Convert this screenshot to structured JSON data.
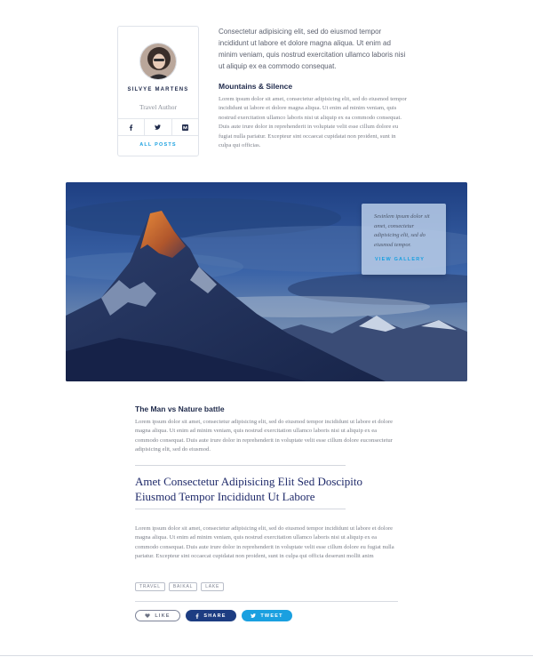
{
  "author": {
    "name": "SILVYE MARTENS",
    "role": "Travel Author",
    "all_posts_label": "ALL POSTS",
    "social": [
      "facebook-icon",
      "twitter-icon",
      "medium-icon"
    ]
  },
  "intro": "Consectetur adipisicing elit, sed do eiusmod tempor incididunt ut labore et dolore magna aliqua. Ut enim ad minim veniam, quis nostrud exercitation ullamco laboris nisi ut aliquip ex ea commodo consequat.",
  "section1": {
    "title": "Mountains & Silence",
    "body": "Lorem ipsum dolor sit amet, consectetur adipisicing elit, sed do eiusmod tempor incididunt ut labore et dolore magna aliqua. Ut enim ad minim veniam, quis nostrud exercitation ullamco laboris nisi ut aliquip ex ea commodo consequat. Duis aute irure dolor in reprehenderit in voluptate velit esse cillum dolore eu fugiat nulla pariatur. Excepteur sint occaecat cupidatat non proident, sunt in culpa qui officias."
  },
  "hero": {
    "caption": "Sesinlem ipsum dolor sit amet, consectetur adipisicing elit, sed do eiusmod tempor.",
    "gallery_label": "VIEW GALLERY"
  },
  "section2": {
    "title": "The Man vs Nature battle",
    "body": "Lorem ipsum dolor sit amet, consectetur adipisicing elit, sed do eiusmod tempor incididunt ut labore et dolore magna aliqua. Ut enim ad minim veniam, quis nostrud exercitation ullamco laboris nisi ut aliquip ex ea commodo consequat. Duis aute irure dolor in reprehenderit in voluptate velit esse cillum dolore euconsectetur adipisicing elit, sed do eiusmod."
  },
  "quote": {
    "line1": "Amet Consectetur Adipisicing Elit Sed Doscipito",
    "line2": "Eiusmod Tempor Incididunt Ut Labore"
  },
  "section3": {
    "body": "Lorem ipsum dolor sit amet, consectetur adipisicing elit, sed do eiusmod tempor incididunt ut labore et dolore magna aliqua. Ut enim ad minim veniam, quis nostrud exercitation ullamco laboris nisi ut aliquip ex ea commodo consequat. Duis aute irure dolor in reprehenderit in voluptate velit esse cillum dolore eu fugiat nulla pariatur. Excepteur sint occaecat cupidatat non proident, sunt in culpa qui officia deserunt mollit anim"
  },
  "tags": [
    "TRAVEL",
    "BAIKAL",
    "LAKE"
  ],
  "actions": {
    "like": "LIKE",
    "share": "SHARE",
    "tweet": "TWEET"
  },
  "colors": {
    "navy": "#1d3d82",
    "accent": "#1aa0e0",
    "heading": "#1f2a4b"
  }
}
